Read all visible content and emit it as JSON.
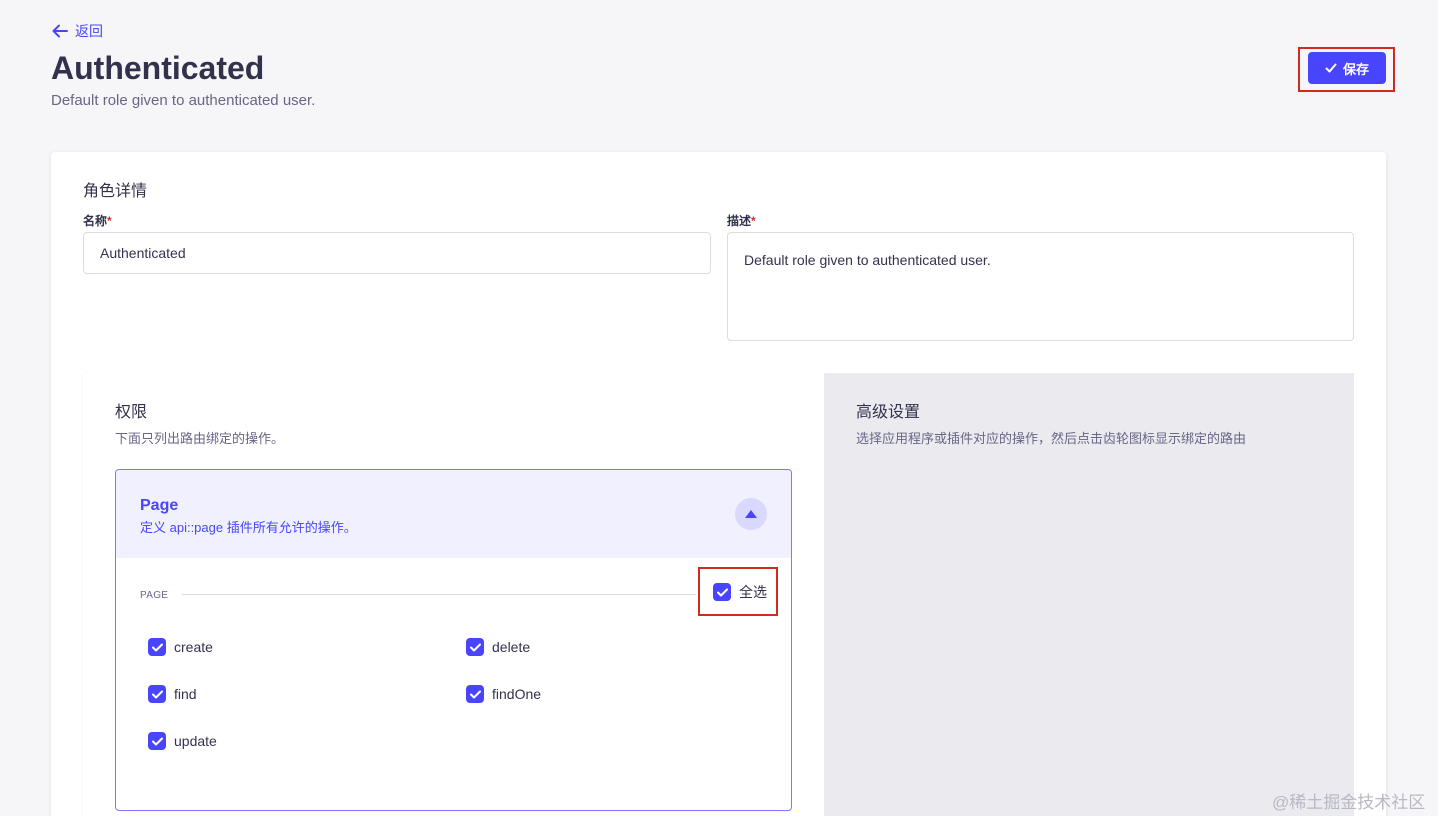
{
  "header": {
    "back_label": "返回",
    "title": "Authenticated",
    "subtitle": "Default role given to authenticated user.",
    "save_label": "保存"
  },
  "role_details": {
    "section_title": "角色详情",
    "name_label": "名称",
    "name_value": "Authenticated",
    "description_label": "描述",
    "description_value": "Default role given to authenticated user.",
    "required_mark": "*"
  },
  "permissions": {
    "title": "权限",
    "subtitle": "下面只列出路由绑定的操作。",
    "accordion": {
      "title": "Page",
      "description": "定义 api::page 插件所有允许的操作。",
      "expanded": true,
      "group_label": "PAGE",
      "select_all_label": "全选",
      "select_all_checked": true,
      "actions": [
        {
          "label": "create",
          "checked": true
        },
        {
          "label": "delete",
          "checked": true
        },
        {
          "label": "find",
          "checked": true
        },
        {
          "label": "findOne",
          "checked": true
        },
        {
          "label": "update",
          "checked": true
        }
      ]
    }
  },
  "advanced": {
    "title": "高级设置",
    "subtitle": "选择应用程序或插件对应的操作，然后点击齿轮图标显示绑定的路由"
  },
  "watermark": "@稀土掘金技术社区",
  "colors": {
    "primary": "#4945ff",
    "highlight_border": "#d02b20",
    "background": "#f6f6f9",
    "advanced_panel": "#eaeaef"
  }
}
